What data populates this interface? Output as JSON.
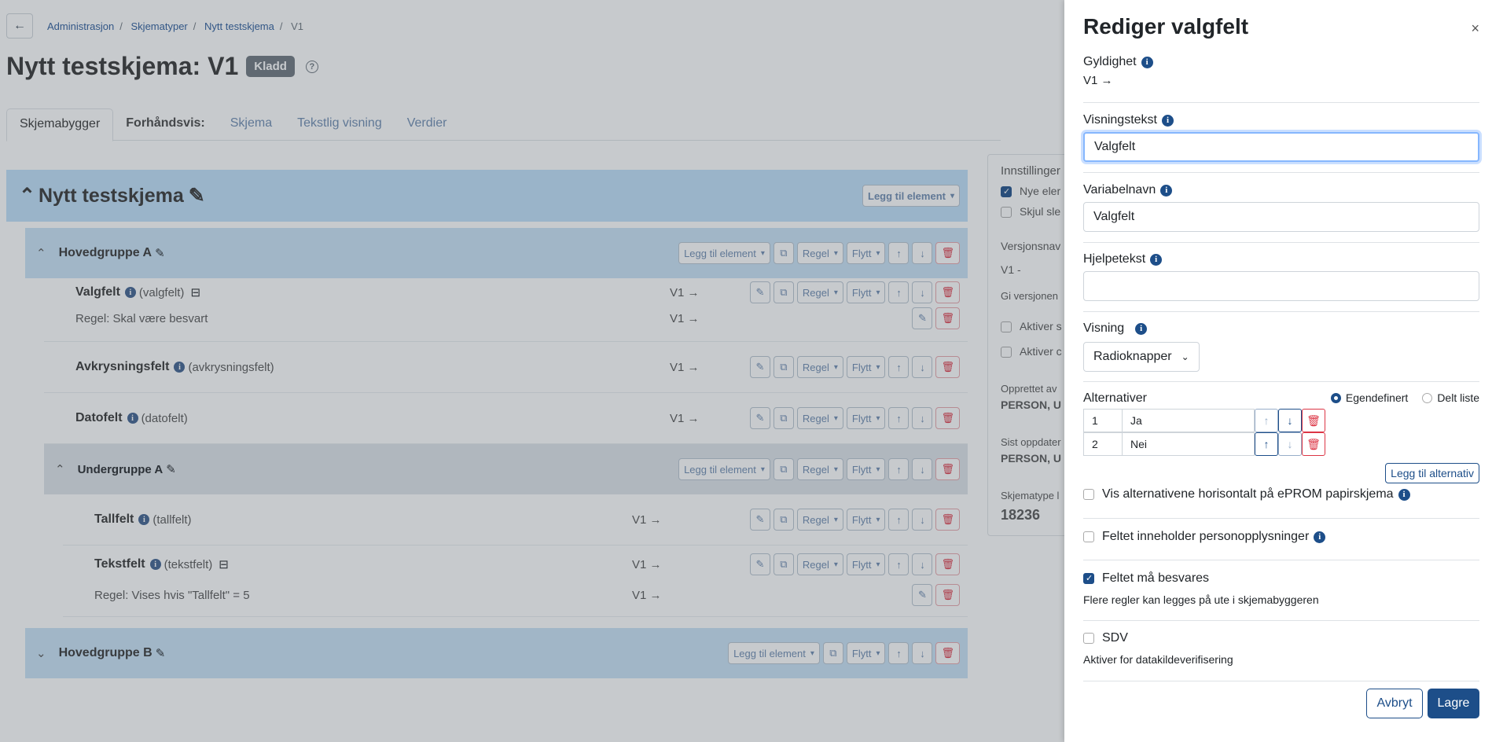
{
  "breadcrumb": [
    "Administrasjon",
    "Skjematyper",
    "Nytt testskjema",
    "V1"
  ],
  "page": {
    "title": "Nytt testskjema: V1",
    "status_badge": "Kladd",
    "help": "?"
  },
  "tabs": [
    "Skjemabygger",
    "Forhåndsvis:",
    "Skjema",
    "Tekstlig visning",
    "Verdier"
  ],
  "builder": {
    "root_title": "Nytt testskjema",
    "add_element": "Legg til element",
    "rule": "Regel",
    "move": "Flytt",
    "group_a": "Hovedgruppe A",
    "group_b": "Hovedgruppe B",
    "subgroup_a": "Undergruppe A",
    "items": [
      {
        "name": "Valgfelt",
        "type": "(valgfelt)",
        "version": "V1 →",
        "rule_text": "Regel: Skal være besvart",
        "rule_version": "V1 →"
      },
      {
        "name": "Avkrysningsfelt",
        "type": "(avkrysningsfelt)",
        "version": "V1 →"
      },
      {
        "name": "Datofelt",
        "type": "(datofelt)",
        "version": "V1 →"
      },
      {
        "name": "Tallfelt",
        "type": "(tallfelt)",
        "version": "V1 →"
      },
      {
        "name": "Tekstfelt",
        "type": "(tekstfelt)",
        "version": "V1 →",
        "rule_text": "Regel: Vises hvis \"Tallfelt\" = 5",
        "rule_version": "V1 →"
      }
    ]
  },
  "side_card": {
    "settings": "Innstillinger",
    "new_elements": "Nye eler",
    "hide": "Skjul sle",
    "version_name": "Versjonsnav",
    "version_prefix": "V1 -",
    "version_hint": "Gi versjonen",
    "activate1": "Aktiver s",
    "activate2": "Aktiver c",
    "created_by": "Opprettet av",
    "created_person": "PERSON, U",
    "updated": "Sist oppdater",
    "updated_person": "PERSON, U",
    "schema_type": "Skjematype l",
    "schema_id": "18236"
  },
  "drawer": {
    "title": "Rediger valgfelt",
    "close": "×",
    "validity_label": "Gyldighet",
    "validity_value": "V1 →",
    "display_text_label": "Visningstekst",
    "display_text_value": "Valgfelt",
    "variable_label": "Variabelnavn",
    "variable_value": "Valgfelt",
    "help_label": "Hjelpetekst",
    "help_value": "",
    "view_label": "Visning",
    "view_value": "Radioknapper",
    "alternatives_label": "Alternativer",
    "radio_custom": "Egendefinert",
    "radio_shared": "Delt liste",
    "alternatives": [
      {
        "num": "1",
        "value": "Ja"
      },
      {
        "num": "2",
        "value": "Nei"
      }
    ],
    "add_alternative": "Legg til alternativ",
    "horizontal_label": "Vis alternativene horisontalt på ePROM papirskjema",
    "personal_label": "Feltet inneholder personopplysninger",
    "required_label": "Feltet må besvares",
    "required_hint": "Flere regler kan legges på ute i skjemabyggeren",
    "sdv_label": "SDV",
    "sdv_hint": "Aktiver for datakildeverifisering",
    "cancel": "Avbryt",
    "save": "Lagre"
  },
  "colors": {
    "primary": "#1d4e89",
    "danger": "#dc3545",
    "group_bg": "#c9e3f7"
  }
}
